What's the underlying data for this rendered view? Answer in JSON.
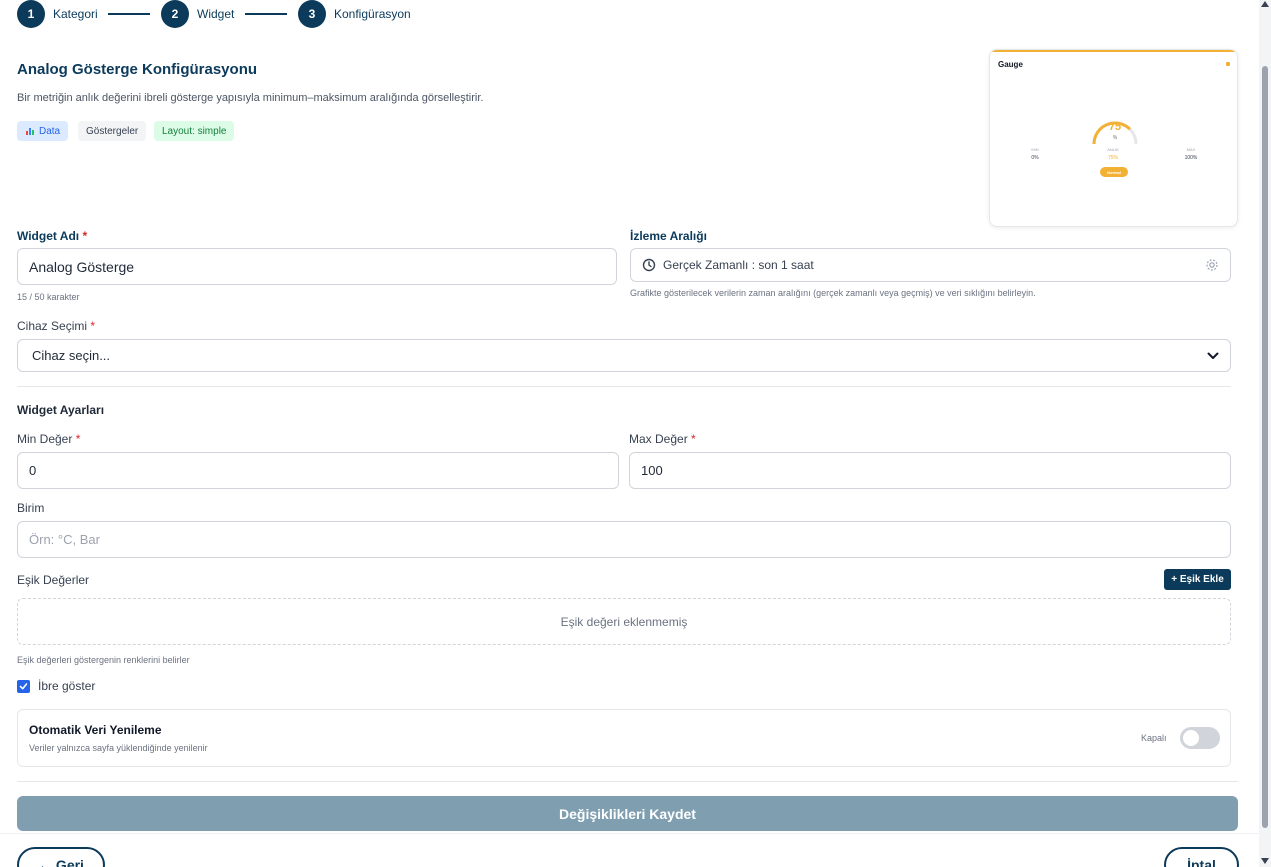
{
  "stepper": {
    "steps": [
      {
        "number": "1",
        "label": "Kategori"
      },
      {
        "number": "2",
        "label": "Widget"
      },
      {
        "number": "3",
        "label": "Konfigürasyon"
      }
    ]
  },
  "header": {
    "title": "Analog Gösterge Konfigürasyonu",
    "description": "Bir metriğin anlık değerini ibreli gösterge yapısıyla minimum–maksimum aralığında görselleştirir.",
    "tags": {
      "data": "Data",
      "category": "Göstergeler",
      "layout": "Layout: simple"
    }
  },
  "preview": {
    "title": "Gauge",
    "value": "75",
    "unit": "%",
    "min_label": "MIN",
    "min_value": "0%",
    "current_label": "ANLIK",
    "current_value": "75%",
    "max_label": "MAX",
    "max_value": "100%",
    "status_badge": "Normal",
    "gauge_fraction": 0.75
  },
  "form": {
    "widget_name": {
      "label": "Widget Adı",
      "required_mark": "*",
      "value": "Analog Gösterge",
      "counter": "15 / 50 karakter"
    },
    "time_range": {
      "label": "İzleme Aralığı",
      "value": "Gerçek Zamanlı : son 1 saat",
      "hint": "Grafikte gösterilecek verilerin zaman aralığını (gerçek zamanlı veya geçmiş) ve veri sıklığını belirleyin."
    },
    "device": {
      "label": "Cihaz Seçimi",
      "required_mark": "*",
      "selected": "Cihaz seçin..."
    },
    "widget_settings": {
      "heading": "Widget Ayarları",
      "min": {
        "label": "Min Değer",
        "required_mark": "*",
        "value": "0"
      },
      "max": {
        "label": "Max Değer",
        "required_mark": "*",
        "value": "100"
      },
      "unit": {
        "label": "Birim",
        "placeholder": "Örn: °C, Bar"
      },
      "thresholds": {
        "label": "Eşik Değerler",
        "add_button": "+ Eşik Ekle",
        "empty_text": "Eşik değeri eklenmemiş",
        "hint": "Eşik değerleri göstergenin renklerini belirler"
      },
      "show_needle": {
        "label": "İbre göster",
        "checked": true
      }
    },
    "auto_refresh": {
      "title": "Otomatik Veri Yenileme",
      "description": "Veriler yalnızca sayfa yüklendiğinde yenilenir",
      "state_label": "Kapalı",
      "enabled": false
    }
  },
  "actions": {
    "save": "Değişiklikleri Kaydet",
    "back": "← Geri",
    "cancel": "İptal"
  },
  "colors": {
    "primary": "#0b3a5a",
    "accent": "#f2b134",
    "save_button": "#7f9fb1",
    "required": "#dc2626"
  }
}
